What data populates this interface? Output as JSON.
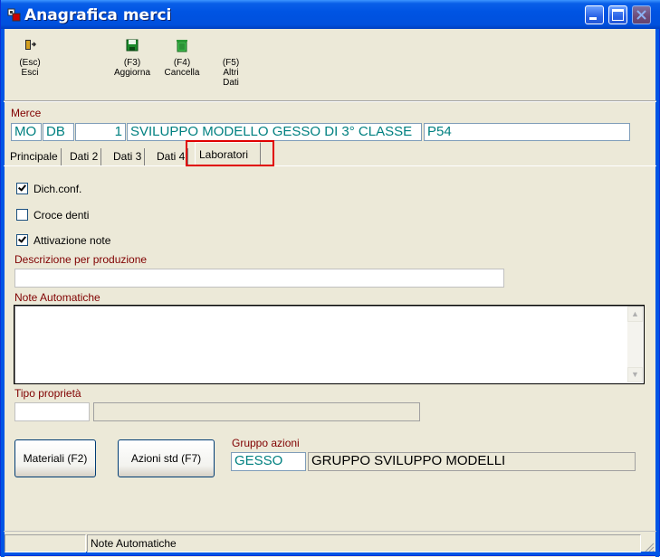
{
  "window": {
    "title": "Anagrafica merci"
  },
  "toolbar": {
    "esci": {
      "key": "(Esc)",
      "label": "Esci",
      "icon": "exit-door-icon"
    },
    "aggiorna": {
      "key": "(F3)",
      "label": "Aggiorna",
      "icon": "save-disk-icon"
    },
    "cancella": {
      "key": "(F4)",
      "label": "Cancella",
      "icon": "trash-bin-icon"
    },
    "altri": {
      "key": "(F5)",
      "label1": "Altri",
      "label2": "Dati"
    }
  },
  "merce": {
    "label": "Merce",
    "field1": "MO",
    "field2": "DB",
    "field3": "1",
    "description": "SVILUPPO MODELLO GESSO DI 3° CLASSE",
    "code": "P54"
  },
  "tabs": [
    {
      "label": "Principale"
    },
    {
      "label": "Dati 2"
    },
    {
      "label": "Dati 3"
    },
    {
      "label": "Dati 4"
    },
    {
      "label": "Laboratori",
      "active": true
    }
  ],
  "checks": {
    "dich_conf": {
      "label": "Dich.conf.",
      "checked": true
    },
    "croce_denti": {
      "label": "Croce denti",
      "checked": false
    },
    "attivazione_note": {
      "label": "Attivazione note",
      "checked": true
    }
  },
  "descrizione": {
    "label": "Descrizione per produzione",
    "value": ""
  },
  "note": {
    "label": "Note Automatiche",
    "value": ""
  },
  "tipo": {
    "label": "Tipo proprietà",
    "value1": "",
    "value2": ""
  },
  "buttons": {
    "materiali": "Materiali (F2)",
    "azioni": "Azioni std (F7)"
  },
  "gruppo": {
    "label": "Gruppo azioni",
    "code": "GESSO",
    "description": "GRUPPO SVILUPPO MODELLI"
  },
  "statusbar": {
    "pane1": "",
    "pane2": "Note Automatiche"
  },
  "colors": {
    "title_blue": "#0054e3",
    "field_label": "#800000",
    "teal_text": "#008080",
    "highlight": "#e00000"
  }
}
